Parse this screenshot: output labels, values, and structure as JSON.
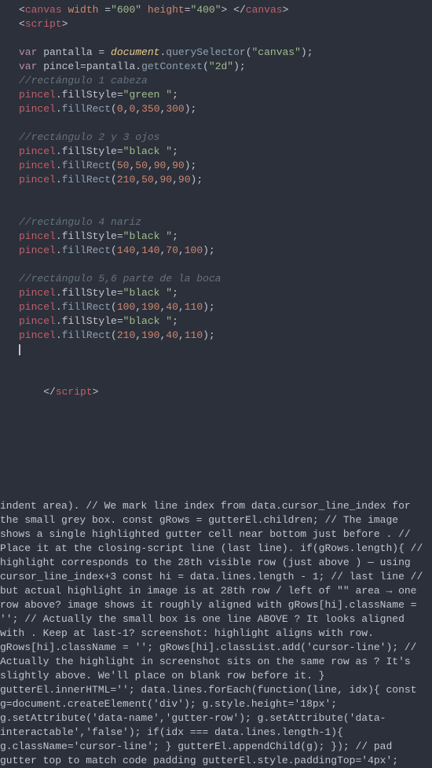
{
  "lines": [
    {
      "segments": [
        {
          "t": "<",
          "c": "t-punc"
        },
        {
          "t": "canvas",
          "c": "t-tag"
        },
        {
          "t": " ",
          "c": "t-default"
        },
        {
          "t": "width",
          "c": "t-attr"
        },
        {
          "t": " =",
          "c": "t-op"
        },
        {
          "t": "\"600\"",
          "c": "t-string"
        },
        {
          "t": " ",
          "c": "t-default"
        },
        {
          "t": "height",
          "c": "t-attr"
        },
        {
          "t": "=",
          "c": "t-op"
        },
        {
          "t": "\"400\"",
          "c": "t-string"
        },
        {
          "t": ">",
          "c": "t-punc"
        },
        {
          "t": " ",
          "c": "t-default"
        },
        {
          "t": "</",
          "c": "t-punc"
        },
        {
          "t": "canvas",
          "c": "t-tag"
        },
        {
          "t": ">",
          "c": "t-punc"
        }
      ]
    },
    {
      "segments": [
        {
          "t": "<",
          "c": "t-punc"
        },
        {
          "t": "script",
          "c": "t-tag"
        },
        {
          "t": ">",
          "c": "t-punc"
        }
      ]
    },
    {
      "blank": true
    },
    {
      "segments": [
        {
          "t": "var",
          "c": "t-keyword"
        },
        {
          "t": " pantalla ",
          "c": "t-default"
        },
        {
          "t": "= ",
          "c": "t-op"
        },
        {
          "t": "document",
          "c": "t-builtin"
        },
        {
          "t": ".",
          "c": "t-punc"
        },
        {
          "t": "querySelector",
          "c": "t-func"
        },
        {
          "t": "(",
          "c": "t-punc"
        },
        {
          "t": "\"canvas\"",
          "c": "t-string"
        },
        {
          "t": ");",
          "c": "t-punc"
        }
      ]
    },
    {
      "segments": [
        {
          "t": "var",
          "c": "t-keyword"
        },
        {
          "t": " ",
          "c": "t-default"
        },
        {
          "t": "pincel",
          "c": "t-default"
        },
        {
          "t": "=",
          "c": "t-op"
        },
        {
          "t": "pantalla.",
          "c": "t-default"
        },
        {
          "t": "getContext",
          "c": "t-func"
        },
        {
          "t": "(",
          "c": "t-punc"
        },
        {
          "t": "\"2d\"",
          "c": "t-string"
        },
        {
          "t": ");",
          "c": "t-punc"
        }
      ]
    },
    {
      "segments": [
        {
          "t": "//rectángulo 1 cabeza",
          "c": "t-comment"
        }
      ]
    },
    {
      "segments": [
        {
          "t": "pincel",
          "c": "t-tag"
        },
        {
          "t": ".",
          "c": "t-punc"
        },
        {
          "t": "fillStyle",
          "c": "t-default"
        },
        {
          "t": "=",
          "c": "t-op"
        },
        {
          "t": "\"green \"",
          "c": "t-string"
        },
        {
          "t": ";",
          "c": "t-punc"
        }
      ]
    },
    {
      "segments": [
        {
          "t": "pincel",
          "c": "t-tag"
        },
        {
          "t": ".",
          "c": "t-punc"
        },
        {
          "t": "fillRect",
          "c": "t-func"
        },
        {
          "t": "(",
          "c": "t-punc"
        },
        {
          "t": "0",
          "c": "t-number"
        },
        {
          "t": ",",
          "c": "t-punc"
        },
        {
          "t": "0",
          "c": "t-number"
        },
        {
          "t": ",",
          "c": "t-punc"
        },
        {
          "t": "350",
          "c": "t-number"
        },
        {
          "t": ",",
          "c": "t-punc"
        },
        {
          "t": "300",
          "c": "t-number"
        },
        {
          "t": ");",
          "c": "t-punc"
        }
      ]
    },
    {
      "blank": true
    },
    {
      "segments": [
        {
          "t": "//rectángulo 2 y 3 ojos",
          "c": "t-comment"
        }
      ]
    },
    {
      "segments": [
        {
          "t": "pincel",
          "c": "t-tag"
        },
        {
          "t": ".",
          "c": "t-punc"
        },
        {
          "t": "fillStyle",
          "c": "t-default"
        },
        {
          "t": "=",
          "c": "t-op"
        },
        {
          "t": "\"black \"",
          "c": "t-string"
        },
        {
          "t": ";",
          "c": "t-punc"
        }
      ]
    },
    {
      "segments": [
        {
          "t": "pincel",
          "c": "t-tag"
        },
        {
          "t": ".",
          "c": "t-punc"
        },
        {
          "t": "fillRect",
          "c": "t-func"
        },
        {
          "t": "(",
          "c": "t-punc"
        },
        {
          "t": "50",
          "c": "t-number"
        },
        {
          "t": ",",
          "c": "t-punc"
        },
        {
          "t": "50",
          "c": "t-number"
        },
        {
          "t": ",",
          "c": "t-punc"
        },
        {
          "t": "90",
          "c": "t-number"
        },
        {
          "t": ",",
          "c": "t-punc"
        },
        {
          "t": "90",
          "c": "t-number"
        },
        {
          "t": ");",
          "c": "t-punc"
        }
      ]
    },
    {
      "segments": [
        {
          "t": "pincel",
          "c": "t-tag"
        },
        {
          "t": ".",
          "c": "t-punc"
        },
        {
          "t": "fillRect",
          "c": "t-func"
        },
        {
          "t": "(",
          "c": "t-punc"
        },
        {
          "t": "210",
          "c": "t-number"
        },
        {
          "t": ",",
          "c": "t-punc"
        },
        {
          "t": "50",
          "c": "t-number"
        },
        {
          "t": ",",
          "c": "t-punc"
        },
        {
          "t": "90",
          "c": "t-number"
        },
        {
          "t": ",",
          "c": "t-punc"
        },
        {
          "t": "90",
          "c": "t-number"
        },
        {
          "t": ");",
          "c": "t-punc"
        }
      ]
    },
    {
      "blank": true
    },
    {
      "blank": true
    },
    {
      "segments": [
        {
          "t": "//rectángulo 4 nariz",
          "c": "t-comment"
        }
      ]
    },
    {
      "segments": [
        {
          "t": "pincel",
          "c": "t-tag"
        },
        {
          "t": ".",
          "c": "t-punc"
        },
        {
          "t": "fillStyle",
          "c": "t-default"
        },
        {
          "t": "=",
          "c": "t-op"
        },
        {
          "t": "\"black \"",
          "c": "t-string"
        },
        {
          "t": ";",
          "c": "t-punc"
        }
      ]
    },
    {
      "segments": [
        {
          "t": "pincel",
          "c": "t-tag"
        },
        {
          "t": ".",
          "c": "t-punc"
        },
        {
          "t": "fillRect",
          "c": "t-func"
        },
        {
          "t": "(",
          "c": "t-punc"
        },
        {
          "t": "140",
          "c": "t-number"
        },
        {
          "t": ",",
          "c": "t-punc"
        },
        {
          "t": "140",
          "c": "t-number"
        },
        {
          "t": ",",
          "c": "t-punc"
        },
        {
          "t": "70",
          "c": "t-number"
        },
        {
          "t": ",",
          "c": "t-punc"
        },
        {
          "t": "100",
          "c": "t-number"
        },
        {
          "t": ");",
          "c": "t-punc"
        }
      ]
    },
    {
      "blank": true
    },
    {
      "segments": [
        {
          "t": "//rectángulo 5,6 parte de la boca",
          "c": "t-comment"
        }
      ]
    },
    {
      "segments": [
        {
          "t": "pincel",
          "c": "t-tag"
        },
        {
          "t": ".",
          "c": "t-punc"
        },
        {
          "t": "fillStyle",
          "c": "t-default"
        },
        {
          "t": "=",
          "c": "t-op"
        },
        {
          "t": "\"black \"",
          "c": "t-string"
        },
        {
          "t": ";",
          "c": "t-punc"
        }
      ]
    },
    {
      "segments": [
        {
          "t": "pincel",
          "c": "t-tag"
        },
        {
          "t": ".",
          "c": "t-punc"
        },
        {
          "t": "fillRect",
          "c": "t-func"
        },
        {
          "t": "(",
          "c": "t-punc"
        },
        {
          "t": "100",
          "c": "t-number"
        },
        {
          "t": ",",
          "c": "t-punc"
        },
        {
          "t": "190",
          "c": "t-number"
        },
        {
          "t": ",",
          "c": "t-punc"
        },
        {
          "t": "40",
          "c": "t-number"
        },
        {
          "t": ",",
          "c": "t-punc"
        },
        {
          "t": "110",
          "c": "t-number"
        },
        {
          "t": ");",
          "c": "t-punc"
        }
      ]
    },
    {
      "segments": [
        {
          "t": "pincel",
          "c": "t-tag"
        },
        {
          "t": ".",
          "c": "t-punc"
        },
        {
          "t": "fillStyle",
          "c": "t-default"
        },
        {
          "t": "=",
          "c": "t-op"
        },
        {
          "t": "\"black \"",
          "c": "t-string"
        },
        {
          "t": ";",
          "c": "t-punc"
        }
      ]
    },
    {
      "segments": [
        {
          "t": "pincel",
          "c": "t-tag"
        },
        {
          "t": ".",
          "c": "t-punc"
        },
        {
          "t": "fillRect",
          "c": "t-func"
        },
        {
          "t": "(",
          "c": "t-punc"
        },
        {
          "t": "210",
          "c": "t-number"
        },
        {
          "t": ",",
          "c": "t-punc"
        },
        {
          "t": "190",
          "c": "t-number"
        },
        {
          "t": ",",
          "c": "t-punc"
        },
        {
          "t": "40",
          "c": "t-number"
        },
        {
          "t": ",",
          "c": "t-punc"
        },
        {
          "t": "110",
          "c": "t-number"
        },
        {
          "t": ");",
          "c": "t-punc"
        }
      ]
    },
    {
      "blank": true,
      "cursor": true
    },
    {
      "blank": true
    },
    {
      "blank": true
    },
    {
      "indent": "    ",
      "segments": [
        {
          "t": "</",
          "c": "t-punc"
        },
        {
          "t": "script",
          "c": "t-tag"
        },
        {
          "t": ">",
          "c": "t-punc"
        }
      ]
    }
  ],
  "cursor_line_index": 24
}
